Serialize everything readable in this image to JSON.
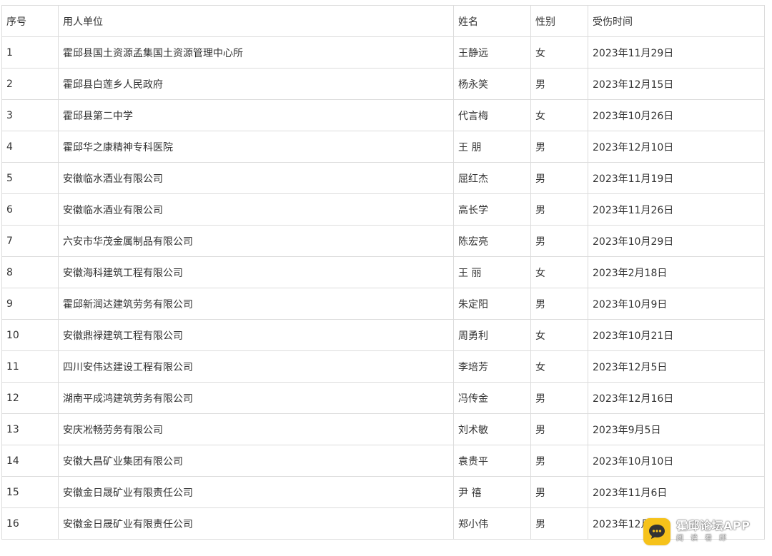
{
  "table": {
    "headers": [
      "序号",
      "用人单位",
      "姓名",
      "性别",
      "受伤时间"
    ],
    "rows": [
      {
        "no": "1",
        "employer": "霍邱县国土资源孟集国土资源管理中心所",
        "name": "王静远",
        "gender": "女",
        "date": "2023年11月29日"
      },
      {
        "no": "2",
        "employer": "霍邱县白莲乡人民政府",
        "name": "杨永笑",
        "gender": "男",
        "date": "2023年12月15日"
      },
      {
        "no": "3",
        "employer": "霍邱县第二中学",
        "name": "代言梅",
        "gender": "女",
        "date": "2023年10月26日"
      },
      {
        "no": "4",
        "employer": "霍邱华之康精神专科医院",
        "name": "王 朋",
        "gender": "男",
        "date": "2023年12月10日"
      },
      {
        "no": "5",
        "employer": "安徽临水酒业有限公司",
        "name": "屈红杰",
        "gender": "男",
        "date": "2023年11月19日"
      },
      {
        "no": "6",
        "employer": "安徽临水酒业有限公司",
        "name": "高长学",
        "gender": "男",
        "date": "2023年11月26日"
      },
      {
        "no": "7",
        "employer": "六安市华茂金属制品有限公司",
        "name": "陈宏亮",
        "gender": "男",
        "date": "2023年10月29日"
      },
      {
        "no": "8",
        "employer": "安徽海科建筑工程有限公司",
        "name": "王 丽",
        "gender": "女",
        "date": "2023年2月18日"
      },
      {
        "no": "9",
        "employer": "霍邱新润达建筑劳务有限公司",
        "name": "朱定阳",
        "gender": "男",
        "date": "2023年10月9日"
      },
      {
        "no": "10",
        "employer": "安徽鼎禄建筑工程有限公司",
        "name": "周勇利",
        "gender": "女",
        "date": "2023年10月21日"
      },
      {
        "no": "11",
        "employer": "四川安伟达建设工程有限公司",
        "name": "李培芳",
        "gender": "女",
        "date": "2023年12月5日"
      },
      {
        "no": "12",
        "employer": "湖南平成鸿建筑劳务有限公司",
        "name": "冯传金",
        "gender": "男",
        "date": "2023年12月16日"
      },
      {
        "no": "13",
        "employer": "安庆凇畅劳务有限公司",
        "name": "刘术敏",
        "gender": "男",
        "date": "2023年9月5日"
      },
      {
        "no": "14",
        "employer": "安徽大昌矿业集团有限公司",
        "name": "袁贵平",
        "gender": "男",
        "date": "2023年10月10日"
      },
      {
        "no": "15",
        "employer": "安徽金日晟矿业有限责任公司",
        "name": "尹 禧",
        "gender": "男",
        "date": "2023年11月6日"
      },
      {
        "no": "16",
        "employer": "安徽金日晟矿业有限责任公司",
        "name": "郑小伟",
        "gender": "男",
        "date": "2023年12月"
      }
    ]
  },
  "watermark": {
    "title": "霍邱论坛APP",
    "subtitle": "阅读看邱",
    "logo_color": "#f6c21a",
    "icon": "chat-bubble-icon"
  }
}
